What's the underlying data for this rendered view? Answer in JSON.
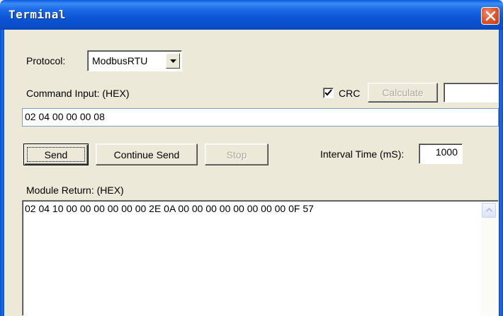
{
  "window": {
    "title": "Terminal"
  },
  "protocol": {
    "label": "Protocol:",
    "selected": "ModbusRTU"
  },
  "command": {
    "label": "Command Input:  (HEX)",
    "value": "02 04 00 00 00 08",
    "crc_label": "CRC",
    "crc_checked": true,
    "calculate_label": "Calculate",
    "crc_value": ""
  },
  "actions": {
    "send_label": "Send",
    "continue_label": "Continue Send",
    "stop_label": "Stop",
    "interval_label": "Interval Time (mS):",
    "interval_value": "1000"
  },
  "module_return": {
    "label": "Module Return:   (HEX)",
    "value": "02 04 10 00 00 00 00 00 00 2E 0A 00 00 00 00 00 00 00 00 0F 57"
  },
  "colors": {
    "titlebar": "#0A4FCB",
    "window_bg": "#ECE9D8",
    "close_button": "#E25A30",
    "disabled_text": "#ACA899"
  },
  "icons": {
    "close": "close-icon",
    "dropdown": "chevron-down-icon",
    "check": "checkmark-icon",
    "scroll_up": "scroll-up-arrow-icon"
  }
}
